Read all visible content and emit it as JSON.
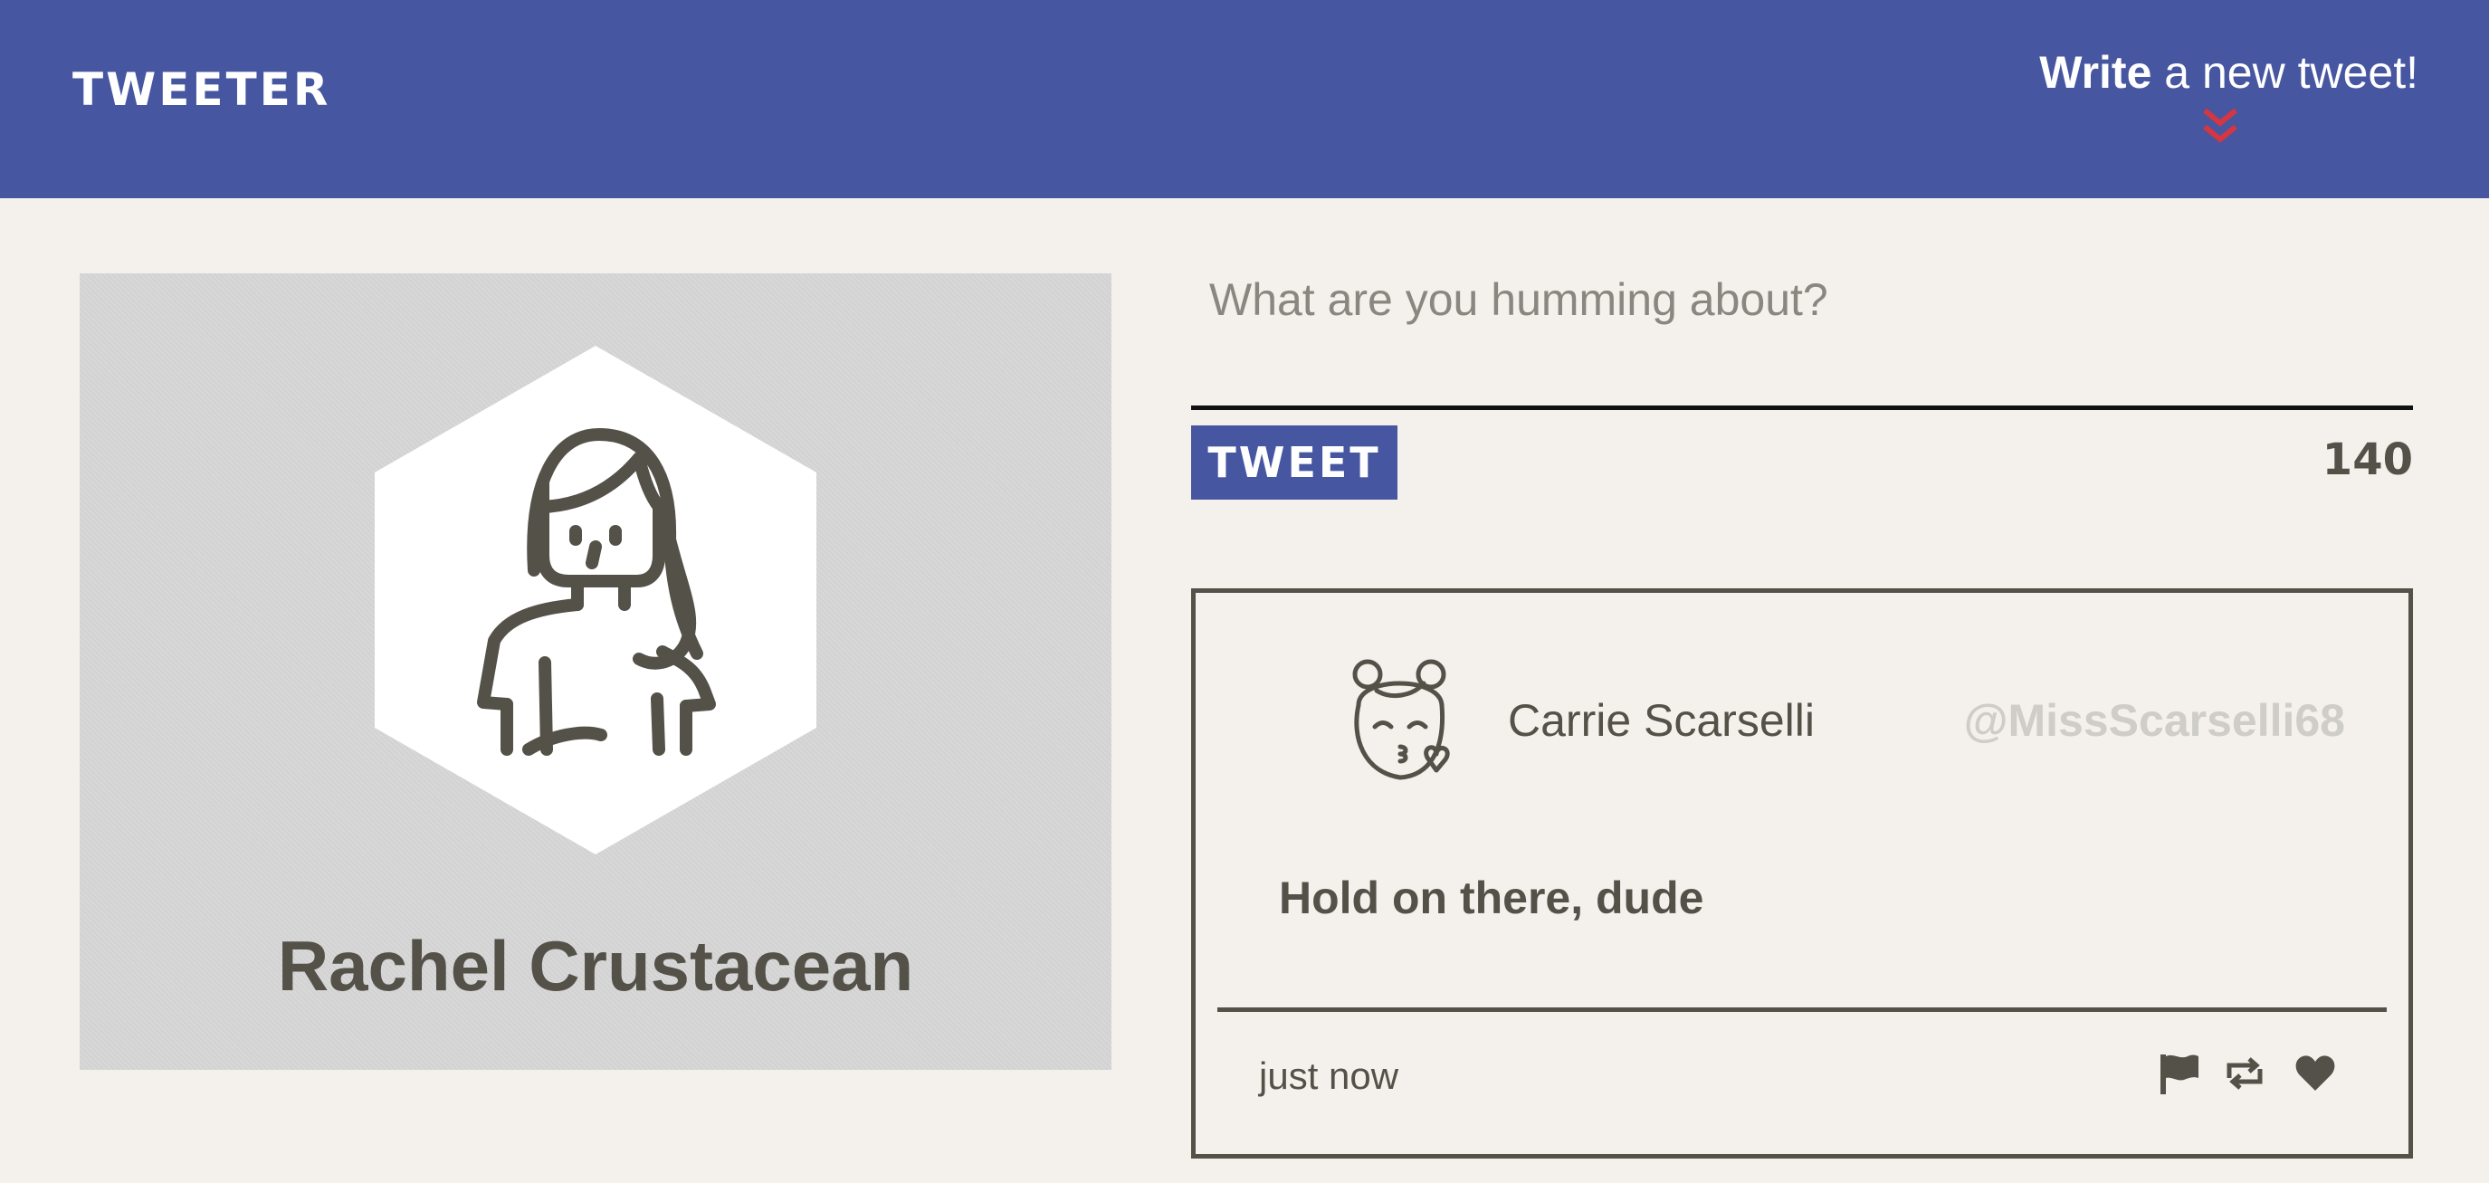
{
  "nav": {
    "brand": "TWEETER",
    "compose_strong": "Write",
    "compose_rest": " a new tweet!"
  },
  "profile": {
    "name": "Rachel Crustacean"
  },
  "composer": {
    "placeholder": "What are you humming about?",
    "value": "",
    "button_label": "TWEET",
    "counter": "140"
  },
  "tweets": [
    {
      "author": "Carrie Scarselli",
      "handle": "@MissScarselli68",
      "body": "Hold on there, dude",
      "time": "just now"
    }
  ],
  "colors": {
    "nav_bg": "#4656a0",
    "page_bg": "#f4f1ec",
    "text": "#545149",
    "chevron": "#d23743",
    "handle": "#cfcdc8",
    "profile_bg": "#d6d6d6"
  },
  "icons": {
    "compose_toggle": "double-chevron-down-icon",
    "profile_avatar": "woman-avatar-icon",
    "tweet_avatar": "girl-kiss-avatar-icon",
    "flag": "flag-icon",
    "retweet": "retweet-icon",
    "like": "heart-icon"
  }
}
